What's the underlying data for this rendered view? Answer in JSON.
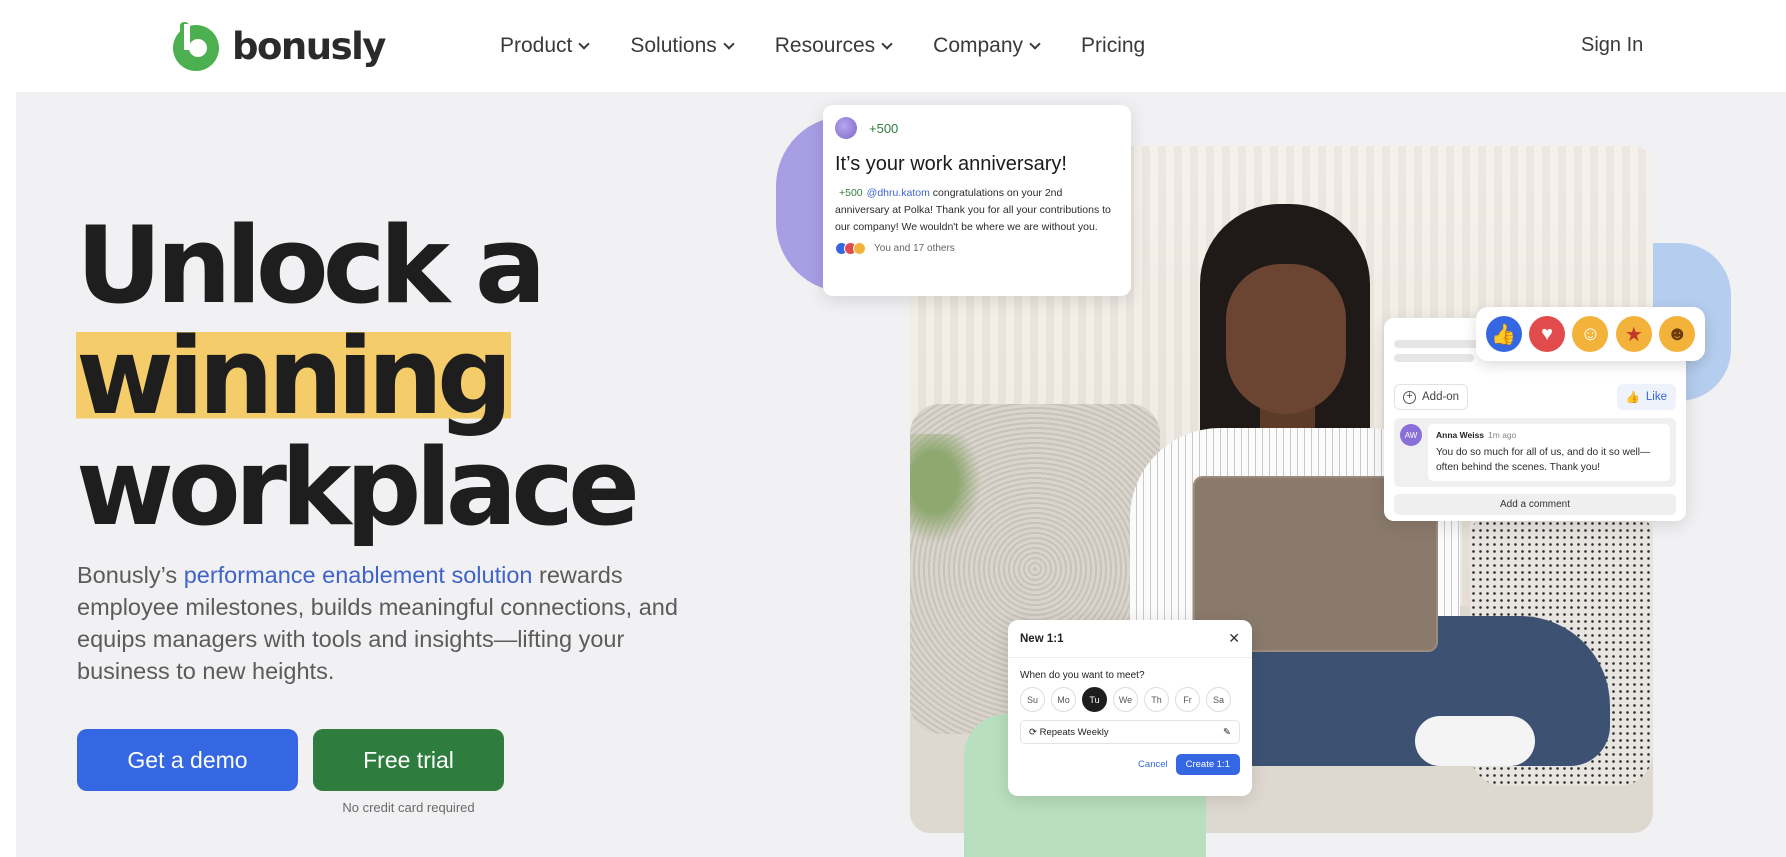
{
  "brand": {
    "name": "bonusly",
    "logo_color": "#4caf50"
  },
  "nav": {
    "items": [
      {
        "label": "Product",
        "has_dropdown": true
      },
      {
        "label": "Solutions",
        "has_dropdown": true
      },
      {
        "label": "Resources",
        "has_dropdown": true
      },
      {
        "label": "Company",
        "has_dropdown": true
      },
      {
        "label": "Pricing",
        "has_dropdown": false
      }
    ],
    "sign_in": "Sign In"
  },
  "hero": {
    "headline": {
      "line1": "Unlock a",
      "line2": "winning",
      "line3": "workplace"
    },
    "description": {
      "before": "Bonusly’s ",
      "link": "performance enablement solution",
      "after": " rewards employee milestones, builds meaningful connections, and equips managers with tools and insights—lifting your business to new heights."
    },
    "cta": {
      "demo": "Get a demo",
      "trial": "Free trial",
      "note": "No credit card required"
    },
    "colors": {
      "highlight": "#f5cc6a",
      "demo_button": "#3567e2",
      "trial_button": "#2f7d3e",
      "link": "#3f63c9"
    }
  },
  "anniversary_card": {
    "points": "+500",
    "title": "It’s your work anniversary!",
    "body_points": "+500",
    "mention": "@dhru.katom",
    "body": " congratulations on your 2nd anniversary at Polka! Thank you for all your contributions to our company! We wouldn't be where we are without you.",
    "reactions": "You and 17 others"
  },
  "comment_card": {
    "addon": "Add-on",
    "like": "Like",
    "avatar": "AW",
    "author": "Anna Weiss",
    "time": "1m ago",
    "text": "You do so much for all of us, and do it so well—often behind the scenes. Thank you!",
    "add_comment": "Add a comment",
    "emojis": [
      "thumbs-up-icon",
      "heart-icon",
      "party-face-icon",
      "star-struck-icon",
      "grinning-face-icon"
    ]
  },
  "meeting_dialog": {
    "title": "New 1:1",
    "question": "When do you want to meet?",
    "days": [
      "Su",
      "Mo",
      "Tu",
      "We",
      "Th",
      "Fr",
      "Sa"
    ],
    "selected_day": "Tu",
    "repeat": "Repeats Weekly",
    "cancel": "Cancel",
    "create": "Create 1:1"
  }
}
